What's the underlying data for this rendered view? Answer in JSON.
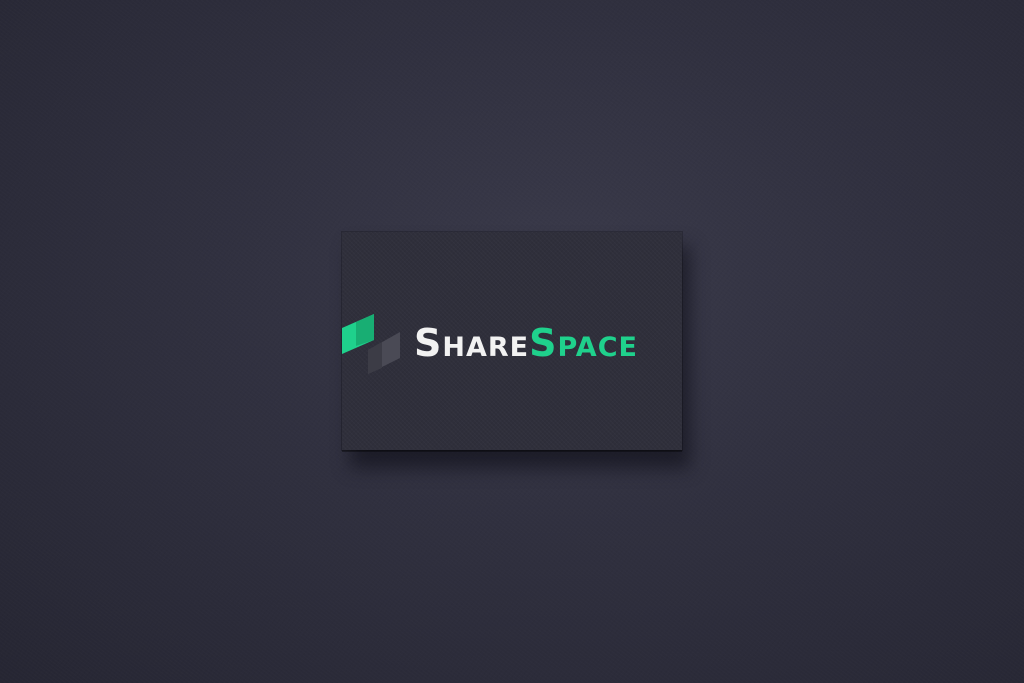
{
  "logo": {
    "word1_initial": "S",
    "word1_rest": "HARE",
    "word2_initial": "S",
    "word2_rest": "PACE",
    "icon": "sharespace-logo-icon"
  },
  "colors": {
    "wall": "#30303f",
    "card": "#2f2f3b",
    "accent_green": "#1fd18c",
    "accent_green_dark": "#17a86f",
    "mark_gray": "#4a4a55",
    "text_white": "#f2f2f2"
  }
}
